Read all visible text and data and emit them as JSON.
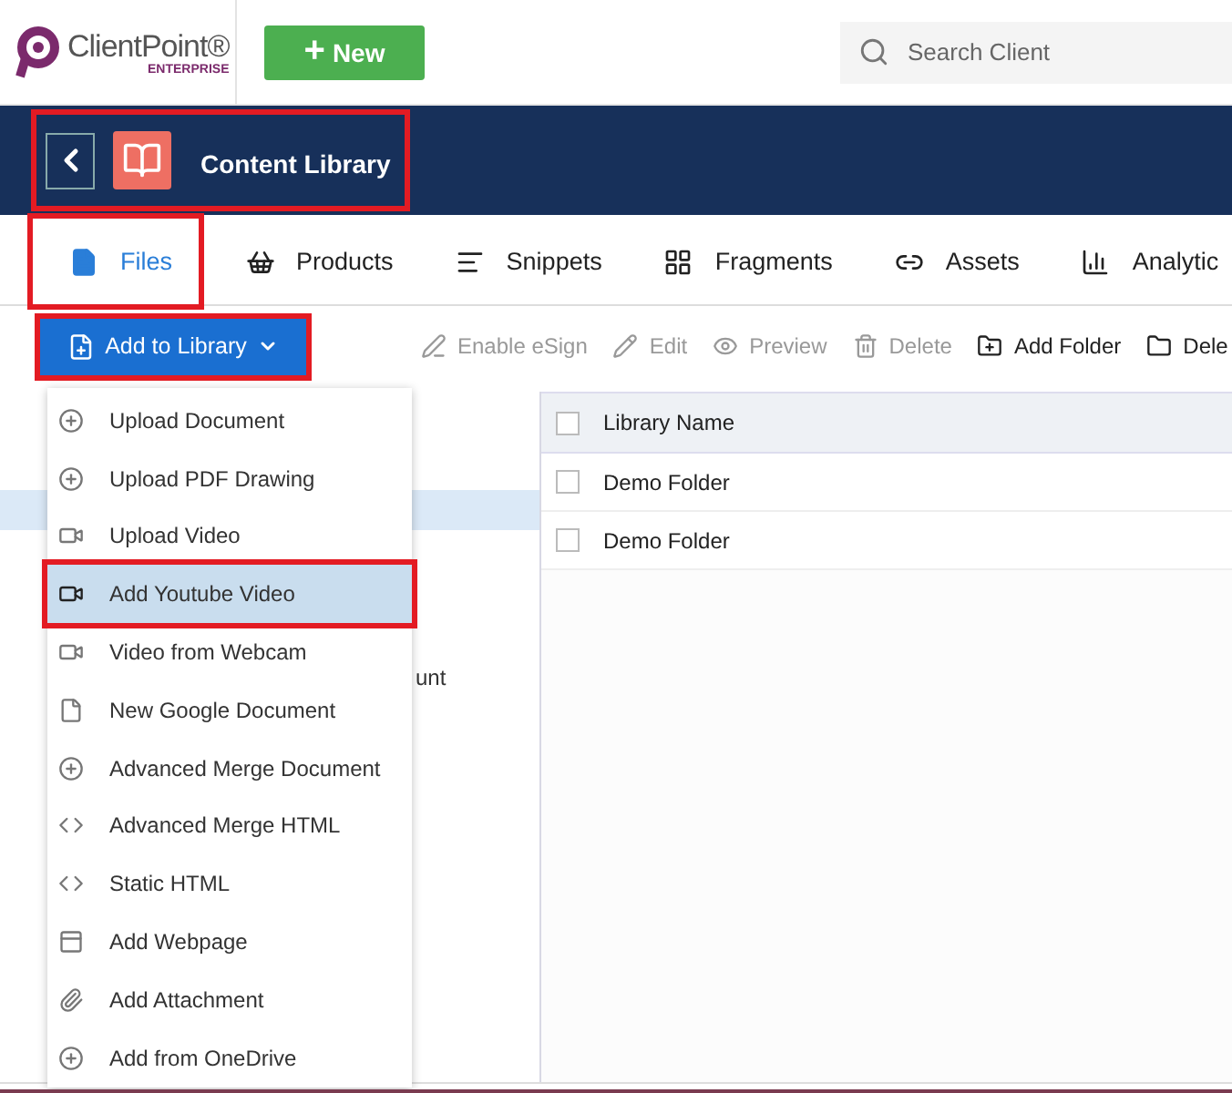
{
  "header": {
    "logo": {
      "name": "ClientPoint",
      "mark": "®",
      "edition": "ENTERPRISE"
    },
    "new_button": {
      "label": "New",
      "icon": "+"
    },
    "search": {
      "placeholder": "Search Client"
    }
  },
  "title_bar": {
    "title": "Content Library",
    "annotated": true
  },
  "tabs": [
    {
      "label": "Files",
      "selected": true,
      "annotated": true
    },
    {
      "label": "Products",
      "selected": false,
      "annotated": false
    },
    {
      "label": "Snippets",
      "selected": false,
      "annotated": false
    },
    {
      "label": "Fragments",
      "selected": false,
      "annotated": false
    },
    {
      "label": "Assets",
      "selected": false,
      "annotated": false
    },
    {
      "label": "Analytic",
      "selected": false,
      "annotated": false
    }
  ],
  "toolbar": {
    "add_button": {
      "label": "Add to Library",
      "annotated": true
    },
    "actions": [
      {
        "label": "Enable eSign",
        "disabled": true
      },
      {
        "label": "Edit",
        "disabled": true
      },
      {
        "label": "Preview",
        "disabled": true
      },
      {
        "label": "Delete",
        "disabled": true
      },
      {
        "label": "Add Folder",
        "disabled": false
      },
      {
        "label": "Dele",
        "disabled": false
      }
    ]
  },
  "sidebar": {
    "items": [
      {
        "selected": true
      },
      {
        "text": "unt",
        "selected": false
      }
    ]
  },
  "menu": [
    {
      "label": "Upload Document",
      "selected": false
    },
    {
      "label": "Upload PDF Drawing",
      "selected": false
    },
    {
      "label": "Upload Video",
      "selected": false
    },
    {
      "label": "Add Youtube Video",
      "selected": true
    },
    {
      "label": "Video from Webcam",
      "selected": false
    },
    {
      "label": "New Google Document",
      "selected": false
    },
    {
      "label": "Advanced Merge Document",
      "selected": false
    },
    {
      "label": "Advanced Merge HTML",
      "selected": false
    },
    {
      "label": "Static HTML",
      "selected": false
    },
    {
      "label": "Add Webpage",
      "selected": false
    },
    {
      "label": "Add Attachment",
      "selected": false
    },
    {
      "label": "Add from OneDrive",
      "selected": false
    }
  ],
  "table": {
    "columns": [
      "Library Name"
    ],
    "header_checked": false,
    "rows": [
      {
        "name": "Demo Folder",
        "checked": false
      },
      {
        "name": "Demo Folder",
        "checked": false
      }
    ]
  }
}
